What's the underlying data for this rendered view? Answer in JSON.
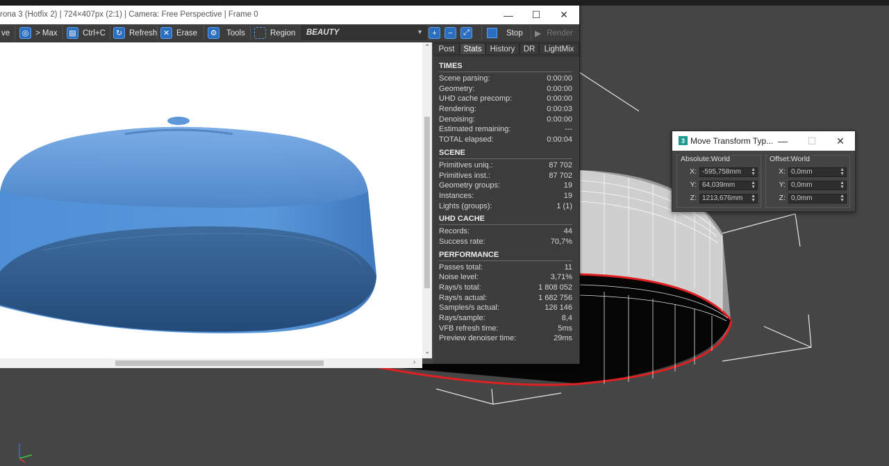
{
  "vfb": {
    "title": "rona 3 (Hotfix 2) | 724×407px (2:1) | Camera: Free Perspective | Frame 0",
    "toolbar": {
      "save_label": "ve",
      "to_max_label": "> Max",
      "copy_label": "Ctrl+C",
      "refresh_label": "Refresh",
      "erase_label": "Erase",
      "tools_label": "Tools",
      "region_label": "Region",
      "pass_value": "BEAUTY",
      "stop_label": "Stop",
      "render_label": "Render"
    }
  },
  "panel": {
    "tabs": [
      "Post",
      "Stats",
      "History",
      "DR",
      "LightMix"
    ],
    "active_tab": "Stats",
    "sections": [
      {
        "title": "TIMES",
        "rows": [
          {
            "label": "Scene parsing:",
            "value": "0:00:00"
          },
          {
            "label": "Geometry:",
            "value": "0:00:00"
          },
          {
            "label": "UHD cache precomp:",
            "value": "0:00:00"
          },
          {
            "label": "Rendering:",
            "value": "0:00:03"
          },
          {
            "label": "Denoising:",
            "value": "0:00:00"
          },
          {
            "label": "Estimated remaining:",
            "value": "---"
          },
          {
            "label": "TOTAL elapsed:",
            "value": "0:00:04"
          }
        ]
      },
      {
        "title": "SCENE",
        "rows": [
          {
            "label": "Primitives uniq.:",
            "value": "87 702"
          },
          {
            "label": "Primitives inst.:",
            "value": "87 702"
          },
          {
            "label": "Geometry groups:",
            "value": "19"
          },
          {
            "label": "Instances:",
            "value": "19"
          },
          {
            "label": "Lights (groups):",
            "value": "1 (1)"
          }
        ]
      },
      {
        "title": "UHD CACHE",
        "rows": [
          {
            "label": "Records:",
            "value": "44"
          },
          {
            "label": "Success rate:",
            "value": "70,7%"
          }
        ]
      },
      {
        "title": "PERFORMANCE",
        "rows": [
          {
            "label": "Passes total:",
            "value": "11"
          },
          {
            "label": "Noise level:",
            "value": "3,71%"
          },
          {
            "label": "Rays/s total:",
            "value": "1 808 052"
          },
          {
            "label": "Rays/s actual:",
            "value": "1 682 756"
          },
          {
            "label": "Samples/s actual:",
            "value": "126 146"
          },
          {
            "label": "Rays/sample:",
            "value": "8,4"
          },
          {
            "label": "VFB refresh time:",
            "value": "5ms"
          },
          {
            "label": "Preview denoiser time:",
            "value": "29ms"
          }
        ]
      }
    ]
  },
  "move_transform": {
    "title": "Move Transform Typ...",
    "icon_letter": "3",
    "absolute": {
      "label": "Absolute:World",
      "x": "-595,758mm",
      "y": "64,039mm",
      "z": "1213,676mm"
    },
    "offset": {
      "label": "Offset:World",
      "x": "0,0mm",
      "y": "0,0mm",
      "z": "0,0mm"
    },
    "axes": {
      "x": "X:",
      "y": "Y:",
      "z": "Z:"
    }
  },
  "colors": {
    "viewport_bg": "#454545",
    "dome": "#5b95d6",
    "selection_edge": "#e02020",
    "accent": "#2a6fbf"
  }
}
